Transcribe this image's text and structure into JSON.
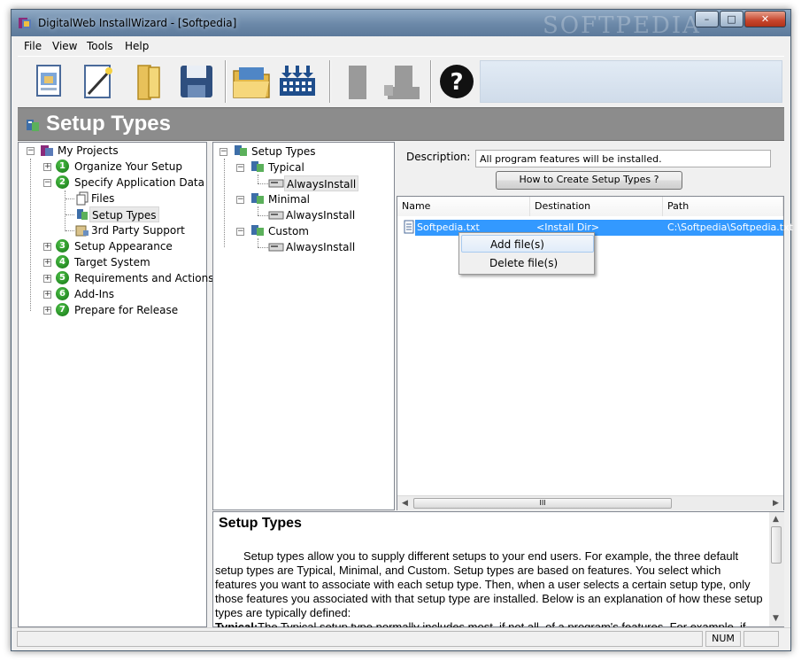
{
  "window": {
    "title": "DigitalWeb InstallWizard - [Softpedia]",
    "watermark": "SOFTPEDIA",
    "min_glyph": "–",
    "max_glyph": "□",
    "close_glyph": "✕"
  },
  "menu": [
    "File",
    "View",
    "Tools",
    "Help"
  ],
  "toolbar": {
    "buttons": [
      "new-project",
      "edit",
      "open-folder",
      "save",
      "open",
      "build",
      "disabled-copy",
      "disabled-run",
      "help"
    ],
    "help_glyph": "?"
  },
  "header": {
    "title": "Setup Types"
  },
  "project_tree": {
    "root": "My Projects",
    "items": [
      {
        "num": "1",
        "label": "Organize Your Setup"
      },
      {
        "num": "2",
        "label": "Specify Application Data"
      },
      {
        "num": "",
        "label": "Files"
      },
      {
        "num": "",
        "label": "Setup Types"
      },
      {
        "num": "",
        "label": "3rd Party Support"
      },
      {
        "num": "3",
        "label": "Setup Appearance"
      },
      {
        "num": "4",
        "label": "Target System"
      },
      {
        "num": "5",
        "label": "Requirements and Actions"
      },
      {
        "num": "6",
        "label": "Add-Ins"
      },
      {
        "num": "7",
        "label": "Prepare for Release"
      }
    ]
  },
  "setup_tree": {
    "root": "Setup Types",
    "types": [
      {
        "name": "Typical",
        "feature": "AlwaysInstall"
      },
      {
        "name": "Minimal",
        "feature": "AlwaysInstall"
      },
      {
        "name": "Custom",
        "feature": "AlwaysInstall"
      }
    ]
  },
  "details": {
    "description_label": "Description:",
    "description_value": "All program features will be installed.",
    "how_to_button": "How to Create Setup Types ?",
    "columns": [
      "Name",
      "Destination",
      "Path"
    ],
    "file_row": {
      "name": "Softpedia.txt",
      "destination": "<Install Dir>",
      "path": "C:\\Softpedia\\Softpedia.txt"
    },
    "scroll_grip": "III"
  },
  "context_menu": [
    "Add file(s)",
    "Delete file(s)"
  ],
  "help_panel": {
    "title": "Setup Types",
    "paragraph": "Setup types allow you to supply different setups to your end users. For example, the three default setup types are Typical, Minimal, and Custom. Setup types are based on features. You select which features you want to associate with each setup type. Then, when a user selects a certain setup type, only those features you associated with that setup type are installed. Below is an explanation of how these setup types are typically defined:",
    "typical_label": "Typical:",
    "typical_text": "The Typical setup type normally includes most, if not all, of a program's features. For example, if"
  },
  "status": {
    "num": "NUM"
  }
}
